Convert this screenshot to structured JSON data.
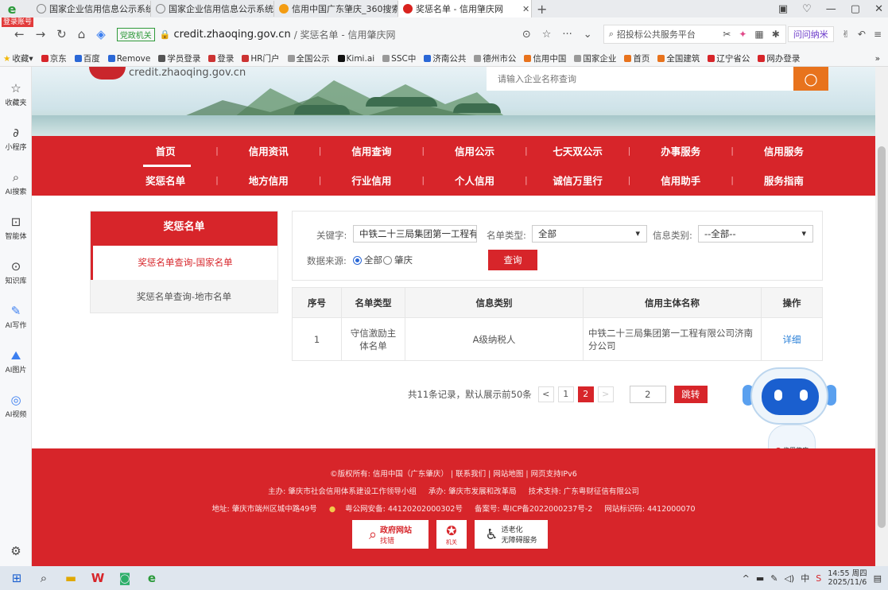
{
  "browser": {
    "login_tag": "登录账号",
    "tabs": [
      {
        "title": "国家企业信用信息公示系统",
        "active": false
      },
      {
        "title": "国家企业信用信息公示系统",
        "active": false
      },
      {
        "title": "信用中国广东肇庆_360搜索",
        "active": false
      },
      {
        "title": "奖惩名单 - 信用肇庆网",
        "active": true
      }
    ],
    "gov_badge": "党政机关",
    "url_host": "credit.zhaoqing.gov.cn",
    "url_rest": "/ 奖惩名单 - 信用肇庆网",
    "search_placeholder": "招投标公共服务平台",
    "ask_button": "问问纳米"
  },
  "bookmarks": [
    "收藏",
    "京东",
    "百度",
    "Remove",
    "学员登录",
    "登录",
    "HR门户",
    "全国公示",
    "Kimi.ai",
    "SSC中",
    "济南公共",
    "德州市公",
    "信用中国",
    "国家企业",
    "首页",
    "全国建筑",
    "辽宁省公",
    "网办登录"
  ],
  "sidebar": [
    {
      "label": "收藏夹",
      "icon": "star-icon",
      "glyph": "☆"
    },
    {
      "label": "小程序",
      "icon": "miniapp-icon",
      "glyph": "∂"
    },
    {
      "label": "AI搜索",
      "icon": "search-icon",
      "glyph": "⌕"
    },
    {
      "label": "智能体",
      "icon": "agent-icon",
      "glyph": "⊡"
    },
    {
      "label": "知识库",
      "icon": "knowledge-icon",
      "glyph": "⊙"
    },
    {
      "label": "AI写作",
      "icon": "pen-icon",
      "glyph": "✎"
    },
    {
      "label": "AI图片",
      "icon": "image-icon",
      "glyph": "⛰"
    },
    {
      "label": "AI视频",
      "icon": "video-icon",
      "glyph": "◎"
    }
  ],
  "site": {
    "url_text": "credit.zhaoqing.gov.cn",
    "search_placeholder": "请输入企业名称查询"
  },
  "nav": {
    "row1": [
      "首页",
      "信用资讯",
      "信用查询",
      "信用公示",
      "七天双公示",
      "办事服务",
      "信用服务"
    ],
    "row2": [
      "奖惩名单",
      "地方信用",
      "行业信用",
      "个人信用",
      "诚信万里行",
      "信用助手",
      "服务指南"
    ]
  },
  "leftpanel": {
    "title": "奖惩名单",
    "items": [
      "奖惩名单查询-国家名单",
      "奖惩名单查询-地市名单"
    ]
  },
  "form": {
    "keyword_label": "关键字:",
    "keyword_value": "中铁二十三局集团第一工程有限",
    "list_type_label": "名单类型:",
    "list_type_value": "全部",
    "info_type_label": "信息类别:",
    "info_type_value": "--全部--",
    "source_label": "数据来源:",
    "source_all": "全部",
    "source_zhaoqing": "肇庆",
    "query_button": "查询"
  },
  "table": {
    "headers": [
      "序号",
      "名单类型",
      "信息类别",
      "信用主体名称",
      "操作"
    ],
    "rows": [
      {
        "no": "1",
        "list_type": "守信激励主体名单",
        "info_type": "A级纳税人",
        "name": "中铁二十三局集团第一工程有限公司济南分公司",
        "action": "详细"
      }
    ]
  },
  "pager": {
    "summary": "共11条记录，默认展示前50条",
    "prev": "<",
    "pages": [
      "1",
      "2"
    ],
    "current": "2",
    "next": ">",
    "jump_value": "2",
    "jump_button": "跳转"
  },
  "robot": {
    "label": "信用肇庆"
  },
  "footer": {
    "copyright": "©版权所有: 信用中国（广东肇庆） | 联系我们 | 网站地图 | 网页支持IPv6",
    "sponsor": "主办: 肇庆市社会信用体系建设工作领导小组",
    "organizer": "承办: 肇庆市发展和改革局",
    "tech": "技术支持: 广东粤财征信有限公司",
    "address": "地址: 肇庆市端州区城中路49号",
    "police": "粤公网安备: 44120202000302号",
    "icp": "备案号: 粤ICP备2022000237号-2",
    "site_code": "网站标识码: 4412000070",
    "badge1_top": "政府网站",
    "badge1_bottom": "找错",
    "badge2": "机关",
    "badge3_top": "适老化",
    "badge3_bottom": "无障碍服务"
  },
  "taskbar": {
    "time": "14:55 周四",
    "date": "2025/11/6",
    "ime": "中"
  },
  "colors": {
    "brand_red": "#d7252a",
    "search_orange": "#e8731d",
    "link_blue": "#2a80d8"
  }
}
